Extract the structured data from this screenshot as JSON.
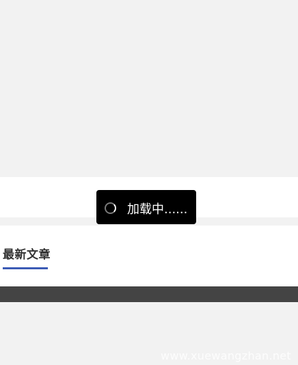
{
  "loading": {
    "text": "加载中......",
    "icon": "spinner-icon"
  },
  "latest_section": {
    "title": "最新文章",
    "accent_color": "#3b5bb5"
  },
  "watermark": {
    "text": "www.xuewangzhan.net"
  },
  "colors": {
    "background": "#f2f2f2",
    "card": "#ffffff",
    "dark_bar": "#444444",
    "toast": "#000000"
  }
}
